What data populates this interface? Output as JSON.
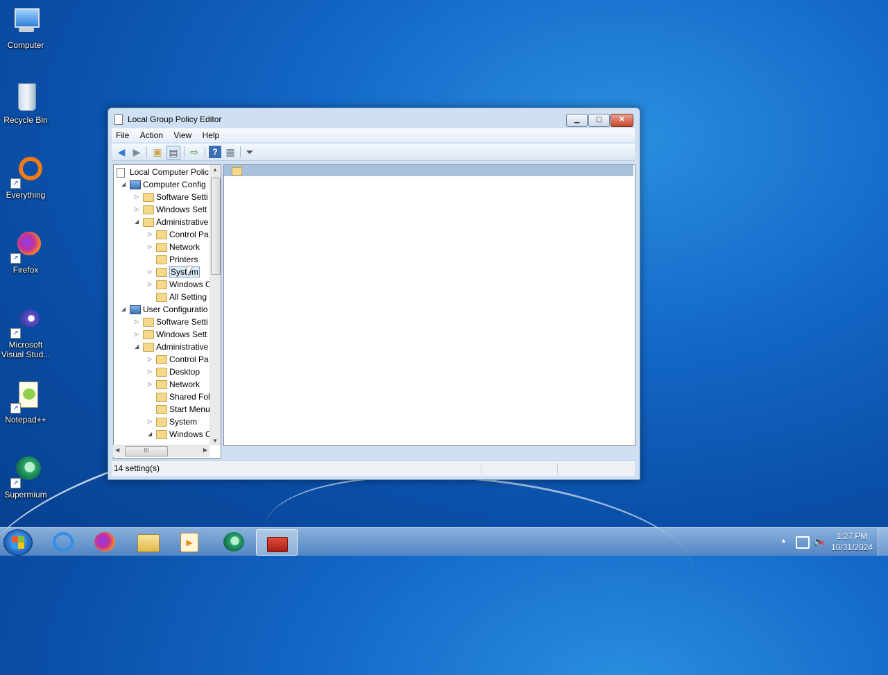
{
  "desktop": {
    "icons": [
      {
        "label": "Computer"
      },
      {
        "label": "Recycle Bin"
      },
      {
        "label": "Everything"
      },
      {
        "label": "Firefox"
      },
      {
        "label": "Microsoft Visual Stud..."
      },
      {
        "label": "Notepad++"
      },
      {
        "label": "Supermium"
      }
    ]
  },
  "window": {
    "title": "Local Group Policy Editor",
    "menu": [
      "File",
      "Action",
      "View",
      "Help"
    ],
    "tree": [
      {
        "label": "Local Computer Polic",
        "level": 0,
        "expander": ""
      },
      {
        "label": "Computer Config",
        "level": 1,
        "expander": "◢"
      },
      {
        "label": "Software Setti",
        "level": 2,
        "expander": "▷"
      },
      {
        "label": "Windows Sett",
        "level": 2,
        "expander": "▷"
      },
      {
        "label": "Administrative",
        "level": 2,
        "expander": "◢"
      },
      {
        "label": "Control Pa",
        "level": 3,
        "expander": "▷"
      },
      {
        "label": "Network",
        "level": 3,
        "expander": "▷"
      },
      {
        "label": "Printers",
        "level": 3,
        "expander": ""
      },
      {
        "label": "System",
        "level": 3,
        "expander": "▷",
        "selected": true
      },
      {
        "label": "Windows C",
        "level": 3,
        "expander": "▷"
      },
      {
        "label": "All Setting",
        "level": 3,
        "expander": ""
      },
      {
        "label": "User Configuratio",
        "level": 1,
        "expander": "◢"
      },
      {
        "label": "Software Setti",
        "level": 2,
        "expander": "▷"
      },
      {
        "label": "Windows Sett",
        "level": 2,
        "expander": "▷"
      },
      {
        "label": "Administrative",
        "level": 2,
        "expander": "◢"
      },
      {
        "label": "Control Pa",
        "level": 3,
        "expander": "▷"
      },
      {
        "label": "Desktop",
        "level": 3,
        "expander": "▷"
      },
      {
        "label": "Network",
        "level": 3,
        "expander": "▷"
      },
      {
        "label": "Shared Fol",
        "level": 3,
        "expander": ""
      },
      {
        "label": "Start Menu",
        "level": 3,
        "expander": ""
      },
      {
        "label": "System",
        "level": 3,
        "expander": "▷"
      },
      {
        "label": "Windows C",
        "level": 3,
        "expander": "◢"
      }
    ],
    "hscroll_thumb": "III",
    "status": "14 setting(s)"
  },
  "taskbar": {
    "clock_time": "1:27 PM",
    "clock_date": "10/31/2024",
    "tray_arrow": "▲"
  },
  "colors": {
    "accent": "#1468c8",
    "selection": "#dbe9f8"
  }
}
